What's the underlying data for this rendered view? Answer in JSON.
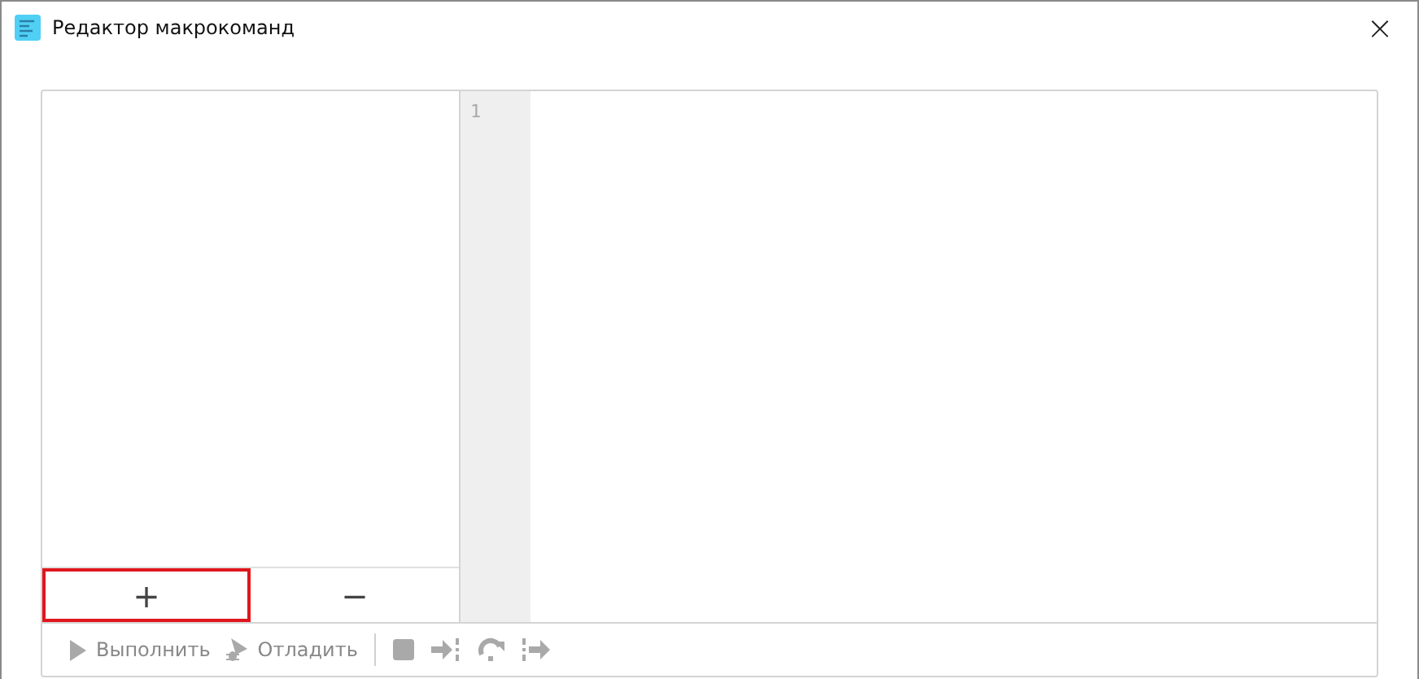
{
  "window": {
    "title": "Редактор макрокоманд",
    "close": "×"
  },
  "list_buttons": [
    {
      "label": "+",
      "focused": true
    },
    {
      "label": "−",
      "focused": false
    }
  ],
  "editor": {
    "line_numbers": [
      "1"
    ]
  },
  "toolbar": [
    {
      "kind": "run",
      "label": "Выполнить",
      "disabled": true
    },
    {
      "kind": "debug",
      "label": "Отладить",
      "disabled": true
    },
    {
      "kind": "separator"
    },
    {
      "kind": "stop",
      "disabled": true
    },
    {
      "kind": "step-into",
      "disabled": true
    },
    {
      "kind": "step-over",
      "disabled": true
    },
    {
      "kind": "step-out",
      "disabled": true
    }
  ]
}
